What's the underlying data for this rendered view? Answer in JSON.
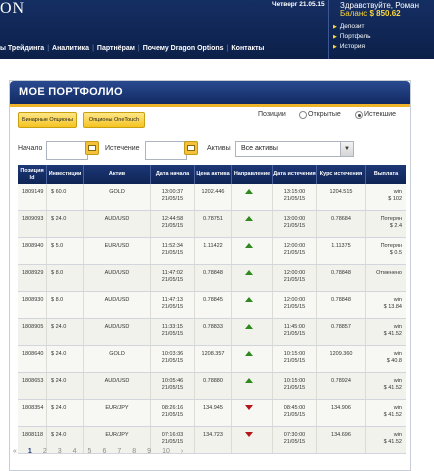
{
  "header": {
    "logo_text": "ON",
    "date": "Четверг 21.05.15",
    "greeting": "Здравствуйте, Роман",
    "balance_label": "Баланс",
    "balance_value": "$ 850.62",
    "links": [
      {
        "label": "Депозит",
        "icon": "arrow-right-icon"
      },
      {
        "label": "Портфель",
        "icon": "arrow-right-icon"
      },
      {
        "label": "История",
        "icon": "arrow-right-icon"
      }
    ],
    "nav": [
      "ы Трейдинга",
      "Аналитика",
      "Партнёрам",
      "Почему Dragon Options",
      "Контакты"
    ]
  },
  "portfolio": {
    "title": "МОЕ ПОРТФОЛИО",
    "btn_binary": "Бинарные Опционы",
    "btn_onetouch": "Опционы OneTouch",
    "positions_label": "Позиции",
    "radio_open": "Открытые",
    "radio_expired": "Истекшие",
    "selected_radio": "Истекшие",
    "filter_start_label": "Начало",
    "filter_start_value": "",
    "filter_expiry_label": "Истечение",
    "filter_expiry_value": "",
    "filter_assets_label": "Активы",
    "filter_assets_value": "Все активы"
  },
  "table": {
    "headers": [
      "Позиция Id",
      "Инвестиции",
      "Актив",
      "Дата начала",
      "Цена актива",
      "Направление",
      "Дата истечения",
      "Курс истечения",
      "Выплата"
    ],
    "rows": [
      {
        "id": "1809149",
        "invest": "$ 60.0",
        "asset": "GOLD",
        "start_time": "13:00:37",
        "start_date": "21/05/15",
        "price": "1202.446",
        "direction": "up",
        "exp_time": "13:15:00",
        "exp_date": "21/05/15",
        "exp_rate": "1204.515",
        "payout_1": "win",
        "payout_2": "$ 102"
      },
      {
        "id": "1809093",
        "invest": "$ 24.0",
        "asset": "AUD/USD",
        "start_time": "12:44:58",
        "start_date": "21/05/15",
        "price": "0.78751",
        "direction": "up",
        "exp_time": "13:00:00",
        "exp_date": "21/05/15",
        "exp_rate": "0.78684",
        "payout_1": "Потерян",
        "payout_2": "$ 2.4"
      },
      {
        "id": "1808940",
        "invest": "$ 5.0",
        "asset": "EUR/USD",
        "start_time": "11:52:34",
        "start_date": "21/05/15",
        "price": "1.11422",
        "direction": "up",
        "exp_time": "12:00:00",
        "exp_date": "21/05/15",
        "exp_rate": "1.11375",
        "payout_1": "Потерян",
        "payout_2": "$ 0.5"
      },
      {
        "id": "1808929",
        "invest": "$ 8.0",
        "asset": "AUD/USD",
        "start_time": "11:47:02",
        "start_date": "21/05/15",
        "price": "0.78848",
        "direction": "up",
        "exp_time": "12:00:00",
        "exp_date": "21/05/15",
        "exp_rate": "0.78848",
        "payout_1": "Отменено",
        "payout_2": ""
      },
      {
        "id": "1808930",
        "invest": "$ 8.0",
        "asset": "AUD/USD",
        "start_time": "11:47:13",
        "start_date": "21/05/15",
        "price": "0.78845",
        "direction": "up",
        "exp_time": "12:00:00",
        "exp_date": "21/05/15",
        "exp_rate": "0.78848",
        "payout_1": "win",
        "payout_2": "$ 13.84"
      },
      {
        "id": "1808905",
        "invest": "$ 24.0",
        "asset": "AUD/USD",
        "start_time": "11:33:15",
        "start_date": "21/05/15",
        "price": "0.78833",
        "direction": "up",
        "exp_time": "11:45:00",
        "exp_date": "21/05/15",
        "exp_rate": "0.78857",
        "payout_1": "win",
        "payout_2": "$ 41.52"
      },
      {
        "id": "1808640",
        "invest": "$ 24.0",
        "asset": "GOLD",
        "start_time": "10:03:36",
        "start_date": "21/05/15",
        "price": "1208.357",
        "direction": "up",
        "exp_time": "10:15:00",
        "exp_date": "21/05/15",
        "exp_rate": "1209.360",
        "payout_1": "win",
        "payout_2": "$ 40.8"
      },
      {
        "id": "1808653",
        "invest": "$ 24.0",
        "asset": "AUD/USD",
        "start_time": "10:05:46",
        "start_date": "21/05/15",
        "price": "0.78880",
        "direction": "up",
        "exp_time": "10:15:00",
        "exp_date": "21/05/15",
        "exp_rate": "0.78924",
        "payout_1": "win",
        "payout_2": "$ 41.52"
      },
      {
        "id": "1808354",
        "invest": "$ 24.0",
        "asset": "EUR/JPY",
        "start_time": "08:26:16",
        "start_date": "21/05/15",
        "price": "134.945",
        "direction": "down",
        "exp_time": "08:45:00",
        "exp_date": "21/05/15",
        "exp_rate": "134.906",
        "payout_1": "win",
        "payout_2": "$ 41.52"
      },
      {
        "id": "1808118",
        "invest": "$ 24.0",
        "asset": "EUR/JPY",
        "start_time": "07:16:03",
        "start_date": "21/05/15",
        "price": "134.723",
        "direction": "down",
        "exp_time": "07:30:00",
        "exp_date": "21/05/15",
        "exp_rate": "134.696",
        "payout_1": "win",
        "payout_2": "$ 41.52"
      }
    ]
  },
  "pagination": {
    "items": [
      "«",
      "1",
      "2",
      "3",
      "4",
      "5",
      "6",
      "7",
      "8",
      "9",
      "10",
      "›"
    ],
    "current": "1"
  },
  "colors": {
    "header_bg": "#0f2555",
    "accent_gold": "#f0b42a",
    "up_arrow": "#2f8a1e",
    "down_arrow": "#b5161a",
    "balance_text": "#ffd83a"
  }
}
